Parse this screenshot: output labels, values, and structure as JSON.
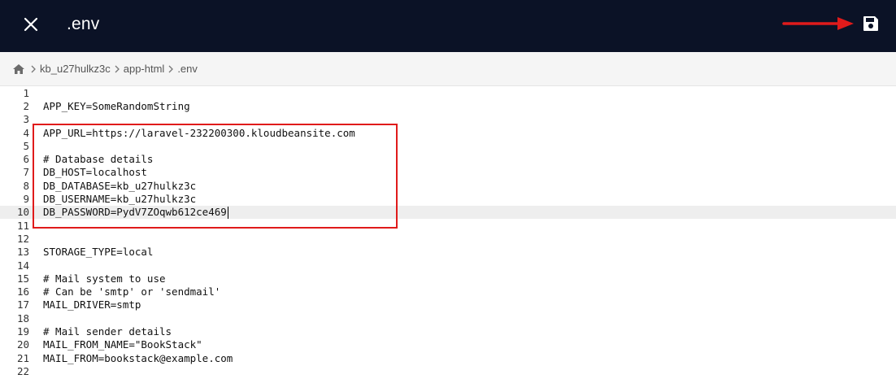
{
  "header": {
    "title": ".env",
    "close_icon": "close-icon",
    "save_icon": "floppy-disk-icon"
  },
  "breadcrumb": {
    "home_icon": "home-icon",
    "items": [
      "kb_u27hulkz3c",
      "app-html",
      ".env"
    ]
  },
  "editor": {
    "active_line": 10,
    "lines": [
      {
        "num": "1",
        "text": ""
      },
      {
        "num": "2",
        "text": "APP_KEY=SomeRandomString"
      },
      {
        "num": "3",
        "text": ""
      },
      {
        "num": "4",
        "text": "APP_URL=https://laravel-232200300.kloudbeansite.com"
      },
      {
        "num": "5",
        "text": ""
      },
      {
        "num": "6",
        "text": "# Database details"
      },
      {
        "num": "7",
        "text": "DB_HOST=localhost"
      },
      {
        "num": "8",
        "text": "DB_DATABASE=kb_u27hulkz3c"
      },
      {
        "num": "9",
        "text": "DB_USERNAME=kb_u27hulkz3c"
      },
      {
        "num": "10",
        "text": "DB_PASSWORD=PydV7ZOqwb612ce469"
      },
      {
        "num": "11",
        "text": ""
      },
      {
        "num": "12",
        "text": ""
      },
      {
        "num": "13",
        "text": "STORAGE_TYPE=local"
      },
      {
        "num": "14",
        "text": ""
      },
      {
        "num": "15",
        "text": "# Mail system to use"
      },
      {
        "num": "16",
        "text": "# Can be 'smtp' or 'sendmail'"
      },
      {
        "num": "17",
        "text": "MAIL_DRIVER=smtp"
      },
      {
        "num": "18",
        "text": ""
      },
      {
        "num": "19",
        "text": "# Mail sender details"
      },
      {
        "num": "20",
        "text": "MAIL_FROM_NAME=\"BookStack\""
      },
      {
        "num": "21",
        "text": "MAIL_FROM=bookstack@example.com"
      },
      {
        "num": "22",
        "text": ""
      }
    ]
  },
  "colors": {
    "topbar": "#0b1226",
    "annotation": "#e01b1b",
    "active_line": "#eeeeee"
  }
}
